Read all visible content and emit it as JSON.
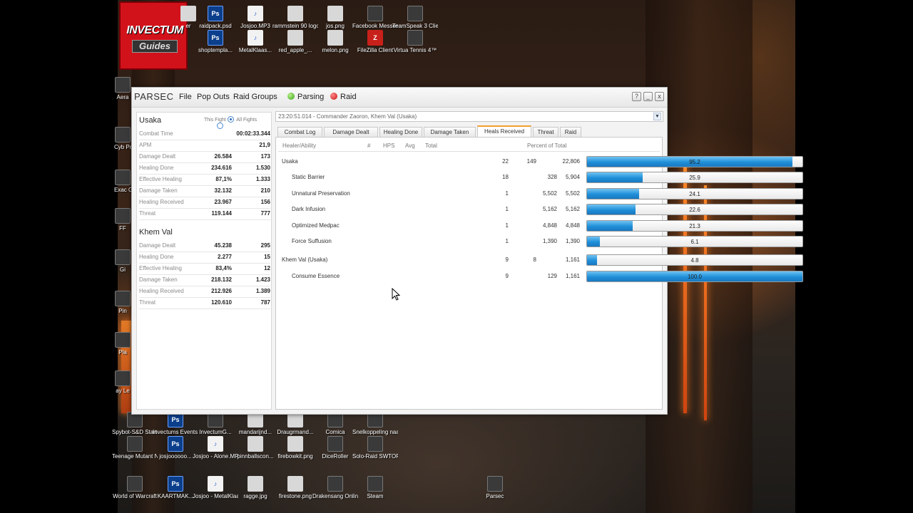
{
  "logo": {
    "line1": "INVECTUM",
    "line2": "Guides"
  },
  "desktop_icons": [
    {
      "label": "er",
      "icon": "image-icon",
      "kind": "g-img"
    },
    {
      "label": "raidpack.psd",
      "icon": "photoshop-icon",
      "kind": "g-ps"
    },
    {
      "label": "Josjoo.MP3",
      "icon": "mp3-icon",
      "kind": "g-mp3"
    },
    {
      "label": "rammstein 90 logo.jpg",
      "icon": "image-icon",
      "kind": "g-img"
    },
    {
      "label": "jos.png",
      "icon": "image-icon",
      "kind": "g-img"
    },
    {
      "label": "Facebook Messenger",
      "icon": "app-icon",
      "kind": "g-app"
    },
    {
      "label": "TeamSpeak 3 Client",
      "icon": "app-icon",
      "kind": "g-app"
    },
    {
      "label": "shoptempla...",
      "icon": "photoshop-icon",
      "kind": "g-ps"
    },
    {
      "label": "MetalKlaas...",
      "icon": "mp3-icon",
      "kind": "g-mp3"
    },
    {
      "label": "red_apple_...",
      "icon": "image-icon",
      "kind": "g-img"
    },
    {
      "label": "melon.png",
      "icon": "image-icon",
      "kind": "g-img"
    },
    {
      "label": "FileZilla Client",
      "icon": "filezilla-icon",
      "kind": "g-fz"
    },
    {
      "label": "Virtua Tennis 4™",
      "icon": "app-icon",
      "kind": "g-app"
    },
    {
      "label": "Aera",
      "icon": "app-icon",
      "kind": "g-app"
    },
    {
      "label": "Cyb Powe",
      "icon": "app-icon",
      "kind": "g-app"
    },
    {
      "label": "Exac Ce",
      "icon": "app-icon",
      "kind": "g-app"
    },
    {
      "label": "FF",
      "icon": "app-icon",
      "kind": "g-app"
    },
    {
      "label": "Gi",
      "icon": "app-icon",
      "kind": "g-app"
    },
    {
      "label": "Pin",
      "icon": "app-icon",
      "kind": "g-app"
    },
    {
      "label": "Pla",
      "icon": "app-icon",
      "kind": "g-app"
    },
    {
      "label": "ay Le",
      "icon": "app-icon",
      "kind": "g-app"
    },
    {
      "label": "Spybot-S&D Start Center",
      "icon": "app-icon",
      "kind": "g-app"
    },
    {
      "label": "Invectums Events.psd",
      "icon": "photoshop-icon",
      "kind": "g-ps"
    },
    {
      "label": "InvectumG...",
      "icon": "app-icon",
      "kind": "g-app"
    },
    {
      "label": "mandarijnd...",
      "icon": "image-icon",
      "kind": "g-img"
    },
    {
      "label": "Draugrmand...",
      "icon": "image-icon",
      "kind": "g-img"
    },
    {
      "label": "Comica",
      "icon": "app-icon",
      "kind": "g-app"
    },
    {
      "label": "Snelkoppeling naar Poker...",
      "icon": "app-icon",
      "kind": "g-app"
    },
    {
      "label": "Teenage Mutant Ninj...",
      "icon": "app-icon",
      "kind": "g-app"
    },
    {
      "label": "josjoooooo...",
      "icon": "photoshop-icon",
      "kind": "g-ps"
    },
    {
      "label": "Josjoo - Alone.MP3",
      "icon": "mp3-icon",
      "kind": "g-mp3"
    },
    {
      "label": "pinnballscon...",
      "icon": "image-icon",
      "kind": "g-img"
    },
    {
      "label": "firebowkit.png",
      "icon": "image-icon",
      "kind": "g-img"
    },
    {
      "label": "DiceRoller",
      "icon": "app-icon",
      "kind": "g-app"
    },
    {
      "label": "Solo-Raid SWTOR MOD",
      "icon": "app-icon",
      "kind": "g-app"
    },
    {
      "label": "World of Warcraft",
      "icon": "app-icon",
      "kind": "g-app"
    },
    {
      "label": "KAARTMAK...",
      "icon": "photoshop-icon",
      "kind": "g-ps"
    },
    {
      "label": "Josjoo - MetalKlaas...",
      "icon": "mp3-icon",
      "kind": "g-mp3"
    },
    {
      "label": "ragge.jpg",
      "icon": "image-icon",
      "kind": "g-img"
    },
    {
      "label": "firestone.png",
      "icon": "image-icon",
      "kind": "g-img"
    },
    {
      "label": "Drakensang Online",
      "icon": "app-icon",
      "kind": "g-app"
    },
    {
      "label": "Steam",
      "icon": "steam-icon",
      "kind": "g-app"
    },
    {
      "label": "Parsec",
      "icon": "parsec-icon",
      "kind": "g-app"
    }
  ],
  "window": {
    "title": "PARSEC",
    "menu": [
      "File",
      "Pop Outs",
      "Raid Groups"
    ],
    "parsing_label": "Parsing",
    "raid_label": "Raid",
    "help": "?",
    "minimize": "_",
    "close": "x"
  },
  "stats": {
    "this_fight": "This Fight",
    "all_fights": "All Fights",
    "players": [
      {
        "name": "Usaka",
        "rows": [
          {
            "label": "Combat Time",
            "wide": "00:02:33.344"
          },
          {
            "label": "APM",
            "wide": "21,9"
          },
          {
            "label": "Damage Dealt",
            "v1": "26.584",
            "v2": "173"
          },
          {
            "label": "Healing Done",
            "v1": "234.616",
            "v2": "1.530"
          },
          {
            "label": "Effective Healing",
            "v1": "87,1%",
            "v2": "1.333"
          },
          {
            "label": "Damage Taken",
            "v1": "32.132",
            "v2": "210"
          },
          {
            "label": "Healing Received",
            "v1": "23.967",
            "v2": "156"
          },
          {
            "label": "Threat",
            "v1": "119.144",
            "v2": "777"
          }
        ]
      },
      {
        "name": "Khem Val",
        "rows": [
          {
            "label": "Damage Dealt",
            "v1": "45.238",
            "v2": "295"
          },
          {
            "label": "Healing Done",
            "v1": "2.277",
            "v2": "15"
          },
          {
            "label": "Effective Healing",
            "v1": "83,4%",
            "v2": "12"
          },
          {
            "label": "Damage Taken",
            "v1": "218.132",
            "v2": "1.423"
          },
          {
            "label": "Healing Received",
            "v1": "212.926",
            "v2": "1.389"
          },
          {
            "label": "Threat",
            "v1": "120.610",
            "v2": "787"
          }
        ]
      }
    ]
  },
  "encounter": "23:20:51.014 - Commander Zaoron, Khem Val (Usaka)",
  "tabs": [
    "Combat Log",
    "Damage Dealt",
    "Healing Done",
    "Damage Taken",
    "Heals Received",
    "Threat",
    "Raid"
  ],
  "active_tab": "Heals Received",
  "table": {
    "headers": {
      "ability": "Healer/Ability",
      "count": "#",
      "hps": "HPS",
      "avg": "Avg",
      "total": "Total",
      "pct": "Percent of Total"
    },
    "rows": [
      {
        "name": "Usaka",
        "count": "22",
        "hps": "149",
        "avg": "",
        "total": "22,806",
        "pct": 95.2,
        "pct_label": "95.2",
        "indent": false
      },
      {
        "name": "Static Barrier",
        "count": "18",
        "hps": "",
        "avg": "328",
        "total": "5,904",
        "pct": 25.9,
        "pct_label": "25.9",
        "indent": true
      },
      {
        "name": "Unnatural Preservation",
        "count": "1",
        "hps": "",
        "avg": "5,502",
        "total": "5,502",
        "pct": 24.1,
        "pct_label": "24.1",
        "indent": true
      },
      {
        "name": "Dark Infusion",
        "count": "1",
        "hps": "",
        "avg": "5,162",
        "total": "5,162",
        "pct": 22.6,
        "pct_label": "22.6",
        "indent": true
      },
      {
        "name": "Optimized Medpac",
        "count": "1",
        "hps": "",
        "avg": "4,848",
        "total": "4,848",
        "pct": 21.3,
        "pct_label": "21.3",
        "indent": true
      },
      {
        "name": "Force Suffusion",
        "count": "1",
        "hps": "",
        "avg": "1,390",
        "total": "1,390",
        "pct": 6.1,
        "pct_label": "6.1",
        "indent": true
      },
      {
        "name": "Khem Val (Usaka)",
        "count": "9",
        "hps": "8",
        "avg": "",
        "total": "1,161",
        "pct": 4.8,
        "pct_label": "4.8",
        "indent": false
      },
      {
        "name": "Consume Essence",
        "count": "9",
        "hps": "",
        "avg": "129",
        "total": "1,161",
        "pct": 100.0,
        "pct_label": "100.0",
        "indent": true
      }
    ]
  }
}
